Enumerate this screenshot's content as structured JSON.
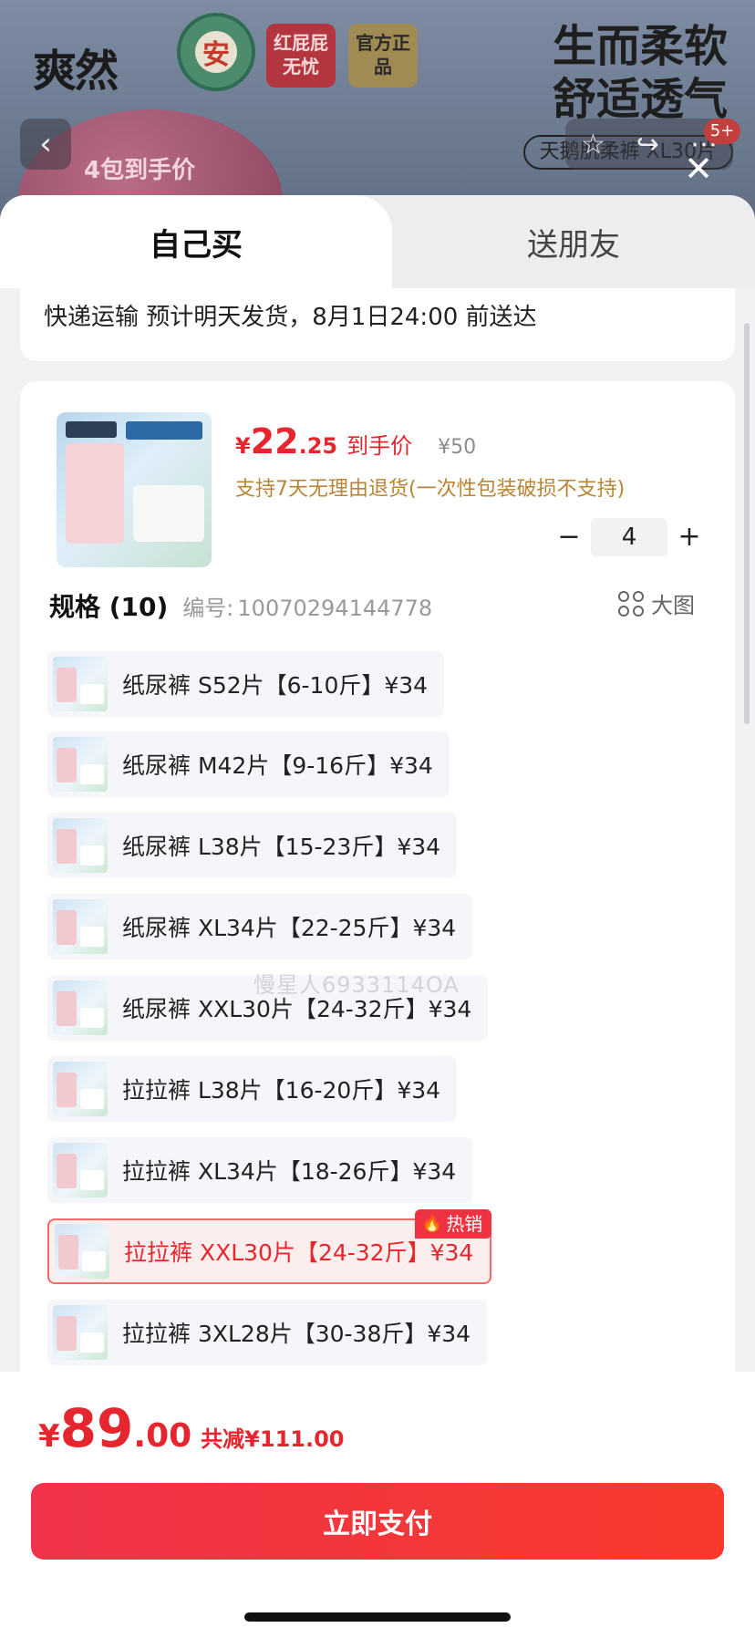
{
  "background": {
    "brand": "爽然",
    "safe_badge": "安",
    "badge_red": "红屁屁无忧",
    "badge_gold": "官方正品",
    "slogan": "生而柔软\n舒适透气",
    "pill": "天鹅肌柔裤 XL30片",
    "promo": "4包到手价",
    "cart_count": "5+"
  },
  "tabs": [
    {
      "label": "自己买",
      "active": true
    },
    {
      "label": "送朋友",
      "active": false
    }
  ],
  "shipping": {
    "text": "快递运输 预计明天发货，8月1日24:00 前送达"
  },
  "product": {
    "price_symbol": "¥",
    "price_int": "22",
    "price_dec": ".25",
    "price_label": "到手价",
    "original_price": "¥50",
    "return_policy": "支持7天无理由退货(一次性包装破损不支持)",
    "quantity": "4",
    "minus": "−",
    "plus": "+"
  },
  "spec": {
    "title": "规格 (10)",
    "sku_label": "编号:",
    "sku": "10070294144778",
    "big_image": "大图"
  },
  "options": [
    {
      "label": "纸尿裤 S52片【6-10斤】¥34",
      "selected": false
    },
    {
      "label": "纸尿裤 M42片【9-16斤】¥34",
      "selected": false
    },
    {
      "label": "纸尿裤 L38片【15-23斤】¥34",
      "selected": false
    },
    {
      "label": "纸尿裤 XL34片【22-25斤】¥34",
      "selected": false
    },
    {
      "label": "纸尿裤 XXL30片【24-32斤】¥34",
      "selected": false
    },
    {
      "label": "拉拉裤 L38片【16-20斤】¥34",
      "selected": false
    },
    {
      "label": "拉拉裤 XL34片【18-26斤】¥34",
      "selected": false
    },
    {
      "label": "拉拉裤 XXL30片【24-32斤】¥34",
      "selected": true,
      "badge": "热销"
    },
    {
      "label": "拉拉裤 3XL28片【30-38斤】¥34",
      "selected": false
    }
  ],
  "watermark": "慢星人6933114OA",
  "footer": {
    "total_symbol": "¥",
    "total_int": "89",
    "total_dec": ".00",
    "saving": "共减¥111.00",
    "pay_button": "立即支付"
  },
  "colors": {
    "accent": "#e5262e",
    "gold": "#b98534",
    "selected_bg": "#fdeeee"
  }
}
